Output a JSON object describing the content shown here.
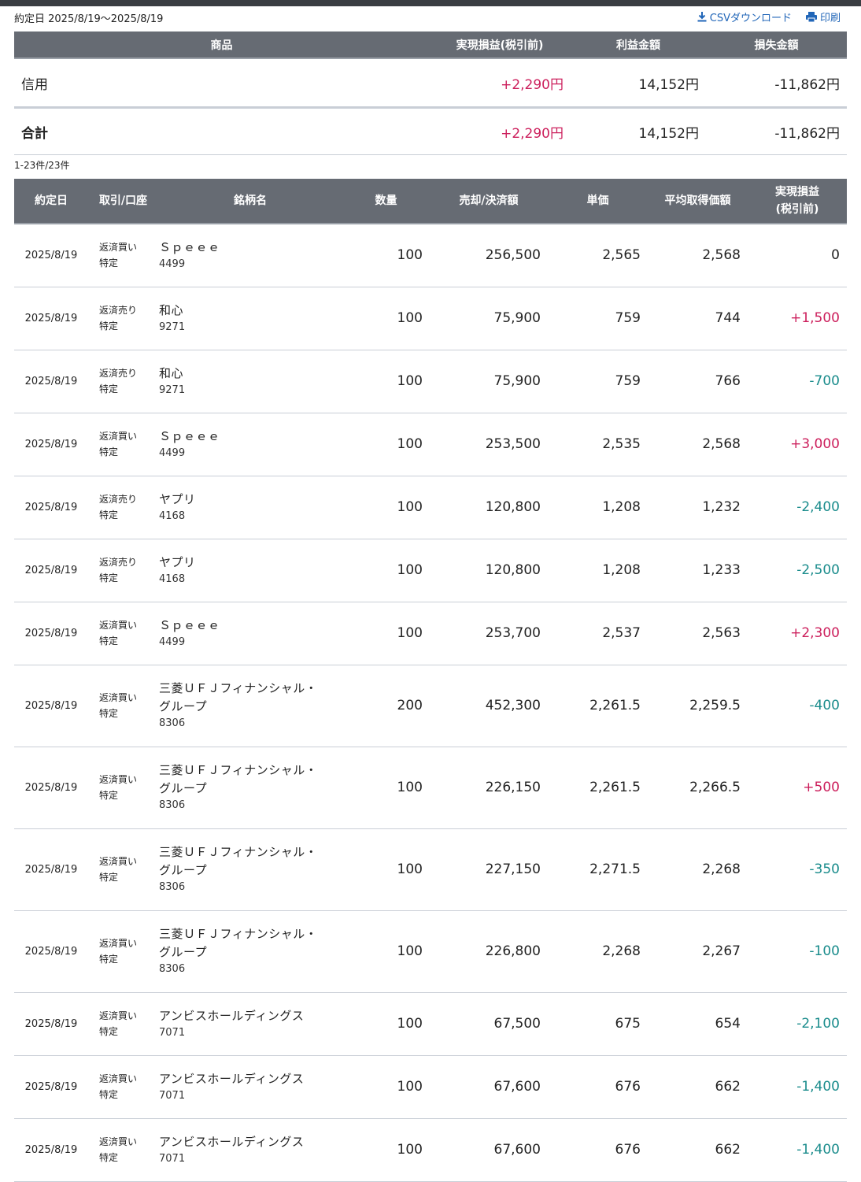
{
  "header": {
    "period": "約定日 2025/8/19〜2025/8/19",
    "csv_label": "CSVダウンロード",
    "print_label": "印刷"
  },
  "summary": {
    "columns": [
      "商品",
      "実現損益(税引前)",
      "利益金額",
      "損失金額"
    ],
    "rows": [
      {
        "label": "信用",
        "pl": "+2,290円",
        "profit": "14,152円",
        "loss": "-11,862円"
      },
      {
        "label": "合計",
        "pl": "+2,290円",
        "profit": "14,152円",
        "loss": "-11,862円"
      }
    ]
  },
  "count_text": "1-23件/23件",
  "detail": {
    "columns": [
      "約定日",
      "取引/口座",
      "銘柄名",
      "数量",
      "売却/決済額",
      "単価",
      "平均取得価額",
      "実現損益\n(税引前)"
    ],
    "rows": [
      {
        "date": "2025/8/19",
        "trade": "返済買い",
        "account": "特定",
        "name": "Ｓｐｅｅｅ",
        "code": "4499",
        "qty": "100",
        "amount": "256,500",
        "price": "2,565",
        "avg": "2,568",
        "pl": "0"
      },
      {
        "date": "2025/8/19",
        "trade": "返済売り",
        "account": "特定",
        "name": "和心",
        "code": "9271",
        "qty": "100",
        "amount": "75,900",
        "price": "759",
        "avg": "744",
        "pl": "+1,500"
      },
      {
        "date": "2025/8/19",
        "trade": "返済売り",
        "account": "特定",
        "name": "和心",
        "code": "9271",
        "qty": "100",
        "amount": "75,900",
        "price": "759",
        "avg": "766",
        "pl": "-700"
      },
      {
        "date": "2025/8/19",
        "trade": "返済買い",
        "account": "特定",
        "name": "Ｓｐｅｅｅ",
        "code": "4499",
        "qty": "100",
        "amount": "253,500",
        "price": "2,535",
        "avg": "2,568",
        "pl": "+3,000"
      },
      {
        "date": "2025/8/19",
        "trade": "返済売り",
        "account": "特定",
        "name": "ヤプリ",
        "code": "4168",
        "qty": "100",
        "amount": "120,800",
        "price": "1,208",
        "avg": "1,232",
        "pl": "-2,400"
      },
      {
        "date": "2025/8/19",
        "trade": "返済売り",
        "account": "特定",
        "name": "ヤプリ",
        "code": "4168",
        "qty": "100",
        "amount": "120,800",
        "price": "1,208",
        "avg": "1,233",
        "pl": "-2,500"
      },
      {
        "date": "2025/8/19",
        "trade": "返済買い",
        "account": "特定",
        "name": "Ｓｐｅｅｅ",
        "code": "4499",
        "qty": "100",
        "amount": "253,700",
        "price": "2,537",
        "avg": "2,563",
        "pl": "+2,300"
      },
      {
        "date": "2025/8/19",
        "trade": "返済買い",
        "account": "特定",
        "name": "三菱ＵＦＪフィナンシャル・グループ",
        "code": "8306",
        "qty": "200",
        "amount": "452,300",
        "price": "2,261.5",
        "avg": "2,259.5",
        "pl": "-400"
      },
      {
        "date": "2025/8/19",
        "trade": "返済買い",
        "account": "特定",
        "name": "三菱ＵＦＪフィナンシャル・グループ",
        "code": "8306",
        "qty": "100",
        "amount": "226,150",
        "price": "2,261.5",
        "avg": "2,266.5",
        "pl": "+500"
      },
      {
        "date": "2025/8/19",
        "trade": "返済買い",
        "account": "特定",
        "name": "三菱ＵＦＪフィナンシャル・グループ",
        "code": "8306",
        "qty": "100",
        "amount": "227,150",
        "price": "2,271.5",
        "avg": "2,268",
        "pl": "-350"
      },
      {
        "date": "2025/8/19",
        "trade": "返済買い",
        "account": "特定",
        "name": "三菱ＵＦＪフィナンシャル・グループ",
        "code": "8306",
        "qty": "100",
        "amount": "226,800",
        "price": "2,268",
        "avg": "2,267",
        "pl": "-100"
      },
      {
        "date": "2025/8/19",
        "trade": "返済買い",
        "account": "特定",
        "name": "アンビスホールディングス",
        "code": "7071",
        "qty": "100",
        "amount": "67,500",
        "price": "675",
        "avg": "654",
        "pl": "-2,100"
      },
      {
        "date": "2025/8/19",
        "trade": "返済買い",
        "account": "特定",
        "name": "アンビスホールディングス",
        "code": "7071",
        "qty": "100",
        "amount": "67,600",
        "price": "676",
        "avg": "662",
        "pl": "-1,400"
      },
      {
        "date": "2025/8/19",
        "trade": "返済買い",
        "account": "特定",
        "name": "アンビスホールディングス",
        "code": "7071",
        "qty": "100",
        "amount": "67,600",
        "price": "676",
        "avg": "662",
        "pl": "-1,400"
      }
    ]
  },
  "colors": {
    "header_bg": "#666b73",
    "positive": "#cc1f5c",
    "negative": "#1a8c8c",
    "link": "#2166b8"
  }
}
